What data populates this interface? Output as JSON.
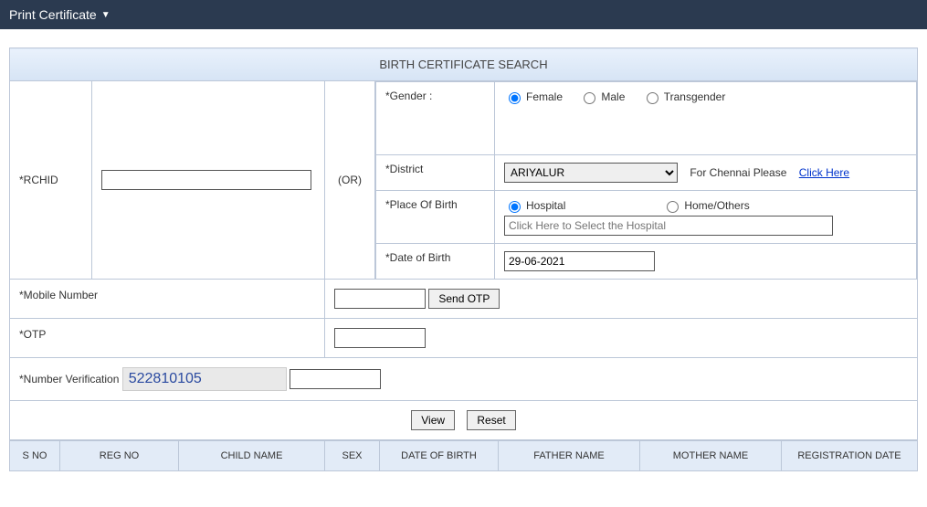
{
  "topbar": {
    "menu_label": "Print Certificate"
  },
  "panel": {
    "title": "BIRTH CERTIFICATE SEARCH",
    "rchid_label": "*RCHID",
    "rchid_value": "",
    "or_label": "(OR)",
    "gender_label": "*Gender :",
    "gender_female": "Female",
    "gender_male": "Male",
    "gender_trans": "Transgender",
    "gender_selected": "female",
    "district_label": "*District",
    "district_selected": "ARIYALUR",
    "chennai_note": "For Chennai Please",
    "chennai_link": "Click Here",
    "pob_label": "*Place Of Birth",
    "pob_hospital": "Hospital",
    "pob_home": "Home/Others",
    "pob_selected": "hospital",
    "hospital_placeholder": "Click Here to Select the Hospital",
    "hospital_value": "",
    "dob_label": "*Date of Birth",
    "dob_value": "29-06-2021",
    "mobile_label": "*Mobile Number",
    "mobile_value": "",
    "sendotp_label": "Send OTP",
    "otp_label": "*OTP",
    "otp_value": "",
    "verification_label": "*Number Verification",
    "captcha_code": "522810105",
    "verification_value": "",
    "view_label": "View",
    "reset_label": "Reset"
  },
  "results": {
    "headers": [
      "S NO",
      "REG NO",
      "CHILD NAME",
      "SEX",
      "DATE OF BIRTH",
      "FATHER NAME",
      "MOTHER NAME",
      "REGISTRATION DATE"
    ]
  }
}
